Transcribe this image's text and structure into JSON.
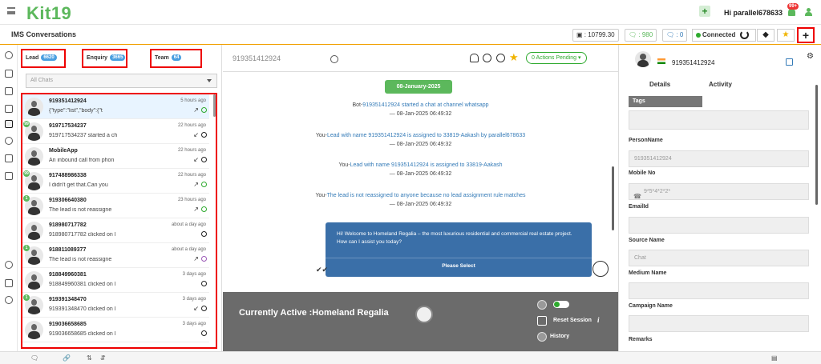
{
  "app": {
    "logo": "Kit19",
    "username": "Hi parallel678633",
    "notif_badge": "99+",
    "page_title": "IMS Conversations"
  },
  "stats": {
    "balance": "10799.30",
    "chats": "980",
    "msgs": "0",
    "connection": "Connected"
  },
  "tabs": [
    {
      "label": "Lead",
      "count": "6620"
    },
    {
      "label": "Enquiry",
      "count": "3665"
    },
    {
      "label": "Team",
      "count": "64"
    }
  ],
  "filter": {
    "placeholder": "All Chats"
  },
  "chats": [
    {
      "number": "919351412924",
      "msg": "{\"type\":\"list\",\"body\":{\"t",
      "time": "5 hours ago",
      "arrow": "↗",
      "badge": ""
    },
    {
      "number": "919717534237",
      "msg": "919717534237 started a ch",
      "time": "22 hours ago",
      "arrow": "↙",
      "badge": "99"
    },
    {
      "number": "MobileApp",
      "msg": "An inbound call from phon",
      "time": "22 hours ago",
      "arrow": "↙",
      "badge": ""
    },
    {
      "number": "917488986338",
      "msg": "I didn't get that.Can you",
      "time": "22 hours ago",
      "arrow": "↗",
      "badge": "99"
    },
    {
      "number": "919306640380",
      "msg": "The lead is not reassigne",
      "time": "23 hours ago",
      "arrow": "↗",
      "badge": "1"
    },
    {
      "number": "918980717782",
      "msg": "918980717782 clicked on l",
      "time": "about a day ago",
      "arrow": "",
      "badge": ""
    },
    {
      "number": "918811089377",
      "msg": "The lead is not reassigne",
      "time": "about a day ago",
      "arrow": "↗",
      "badge": "1"
    },
    {
      "number": "918849960381",
      "msg": "918849960381 clicked on l",
      "time": "3 days ago",
      "arrow": "",
      "badge": ""
    },
    {
      "number": "919391348470",
      "msg": "919391348470 clicked on l",
      "time": "3 days ago",
      "arrow": "↙",
      "badge": "1"
    },
    {
      "number": "919036658685",
      "msg": "919036658685 clicked on l",
      "time": "3 days ago",
      "arrow": "",
      "badge": ""
    }
  ],
  "conversation": {
    "number": "919351412924",
    "actions": "0  Actions Pending",
    "date": "08-January-2025",
    "events": [
      {
        "prefix": "Bot-",
        "link": "919351412924 started a chat at channel whatsapp",
        "stamp": "— 08-Jan-2025 06:49:32"
      },
      {
        "prefix": "You-",
        "link": "Lead with name 919351412924 is assigned to 33819-Aakash by parallel678633",
        "stamp": "— 08-Jan-2025 06:49:32"
      },
      {
        "prefix": "You-",
        "link": "Lead with name 919351412924 is assigned to 33819-Aakash",
        "stamp": "— 08-Jan-2025 06:49:32"
      },
      {
        "prefix": "You-",
        "link": "The lead is not reassigned to anyone because no lead assignment rule matches",
        "stamp": "— 08-Jan-2025 06:49:32"
      }
    ],
    "bubble": "Hi! Welcome to Homeland Regalia – the most luxurious residential and commercial real estate project. How can I assist you today?",
    "bubble_action": "Please Select",
    "active_label": "Currently Active :Homeland Regalia",
    "reset": "Reset Session",
    "history": "History"
  },
  "profile": {
    "number": "919351412924",
    "tabs": [
      "Details",
      "Activity"
    ],
    "tags_header": "Tags",
    "fields": [
      {
        "label": "PersonName",
        "value": "919351412924"
      },
      {
        "label": "Mobile No",
        "value": "9*5*4*2*2*"
      },
      {
        "label": "EmailId",
        "value": ""
      },
      {
        "label": "Source Name",
        "value": "Chat"
      },
      {
        "label": "Medium Name",
        "value": ""
      },
      {
        "label": "Campaign Name",
        "value": ""
      },
      {
        "label": "Remarks",
        "value": ""
      }
    ]
  }
}
